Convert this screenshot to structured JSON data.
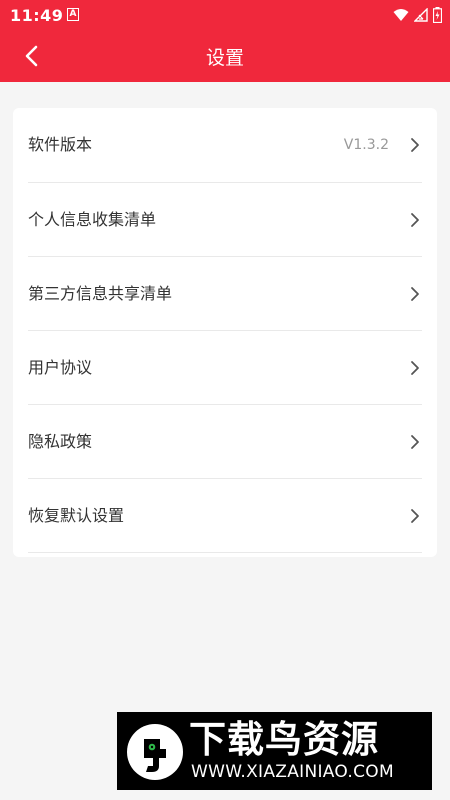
{
  "status_bar": {
    "time": "11:49",
    "app_icon_letter": "A"
  },
  "header": {
    "title": "设置"
  },
  "settings": {
    "items": [
      {
        "label": "软件版本",
        "value": "V1.3.2"
      },
      {
        "label": "个人信息收集清单"
      },
      {
        "label": "第三方信息共享清单"
      },
      {
        "label": "用户协议"
      },
      {
        "label": "隐私政策"
      },
      {
        "label": "恢复默认设置"
      }
    ]
  },
  "watermark": {
    "title": "下载鸟资源",
    "url": "WWW.XIAZAINIAO.COM"
  },
  "colors": {
    "brand": "#f0283c",
    "background": "#f5f5f5",
    "card": "#ffffff",
    "text": "#333333",
    "muted": "#999999"
  }
}
